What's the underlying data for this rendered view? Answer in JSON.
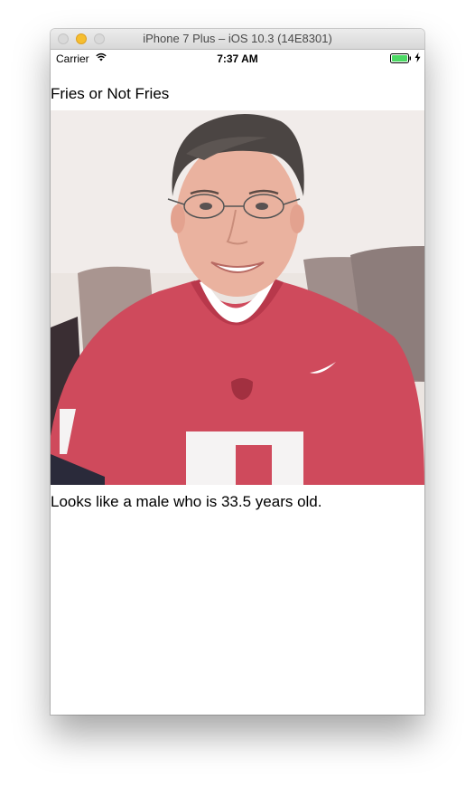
{
  "window": {
    "title": "iPhone 7 Plus – iOS 10.3 (14E8301)"
  },
  "status_bar": {
    "carrier": "Carrier",
    "time": "7:37 AM",
    "icons": [
      "wifi-icon",
      "battery-icon",
      "charging-icon"
    ],
    "battery_color": "#4cd964"
  },
  "app": {
    "title": "Fries or Not Fries",
    "photo": {
      "subject": "selfie of a man wearing glasses and a red number 7 jersey"
    },
    "result": "Looks like a male who is 33.5 years old."
  }
}
